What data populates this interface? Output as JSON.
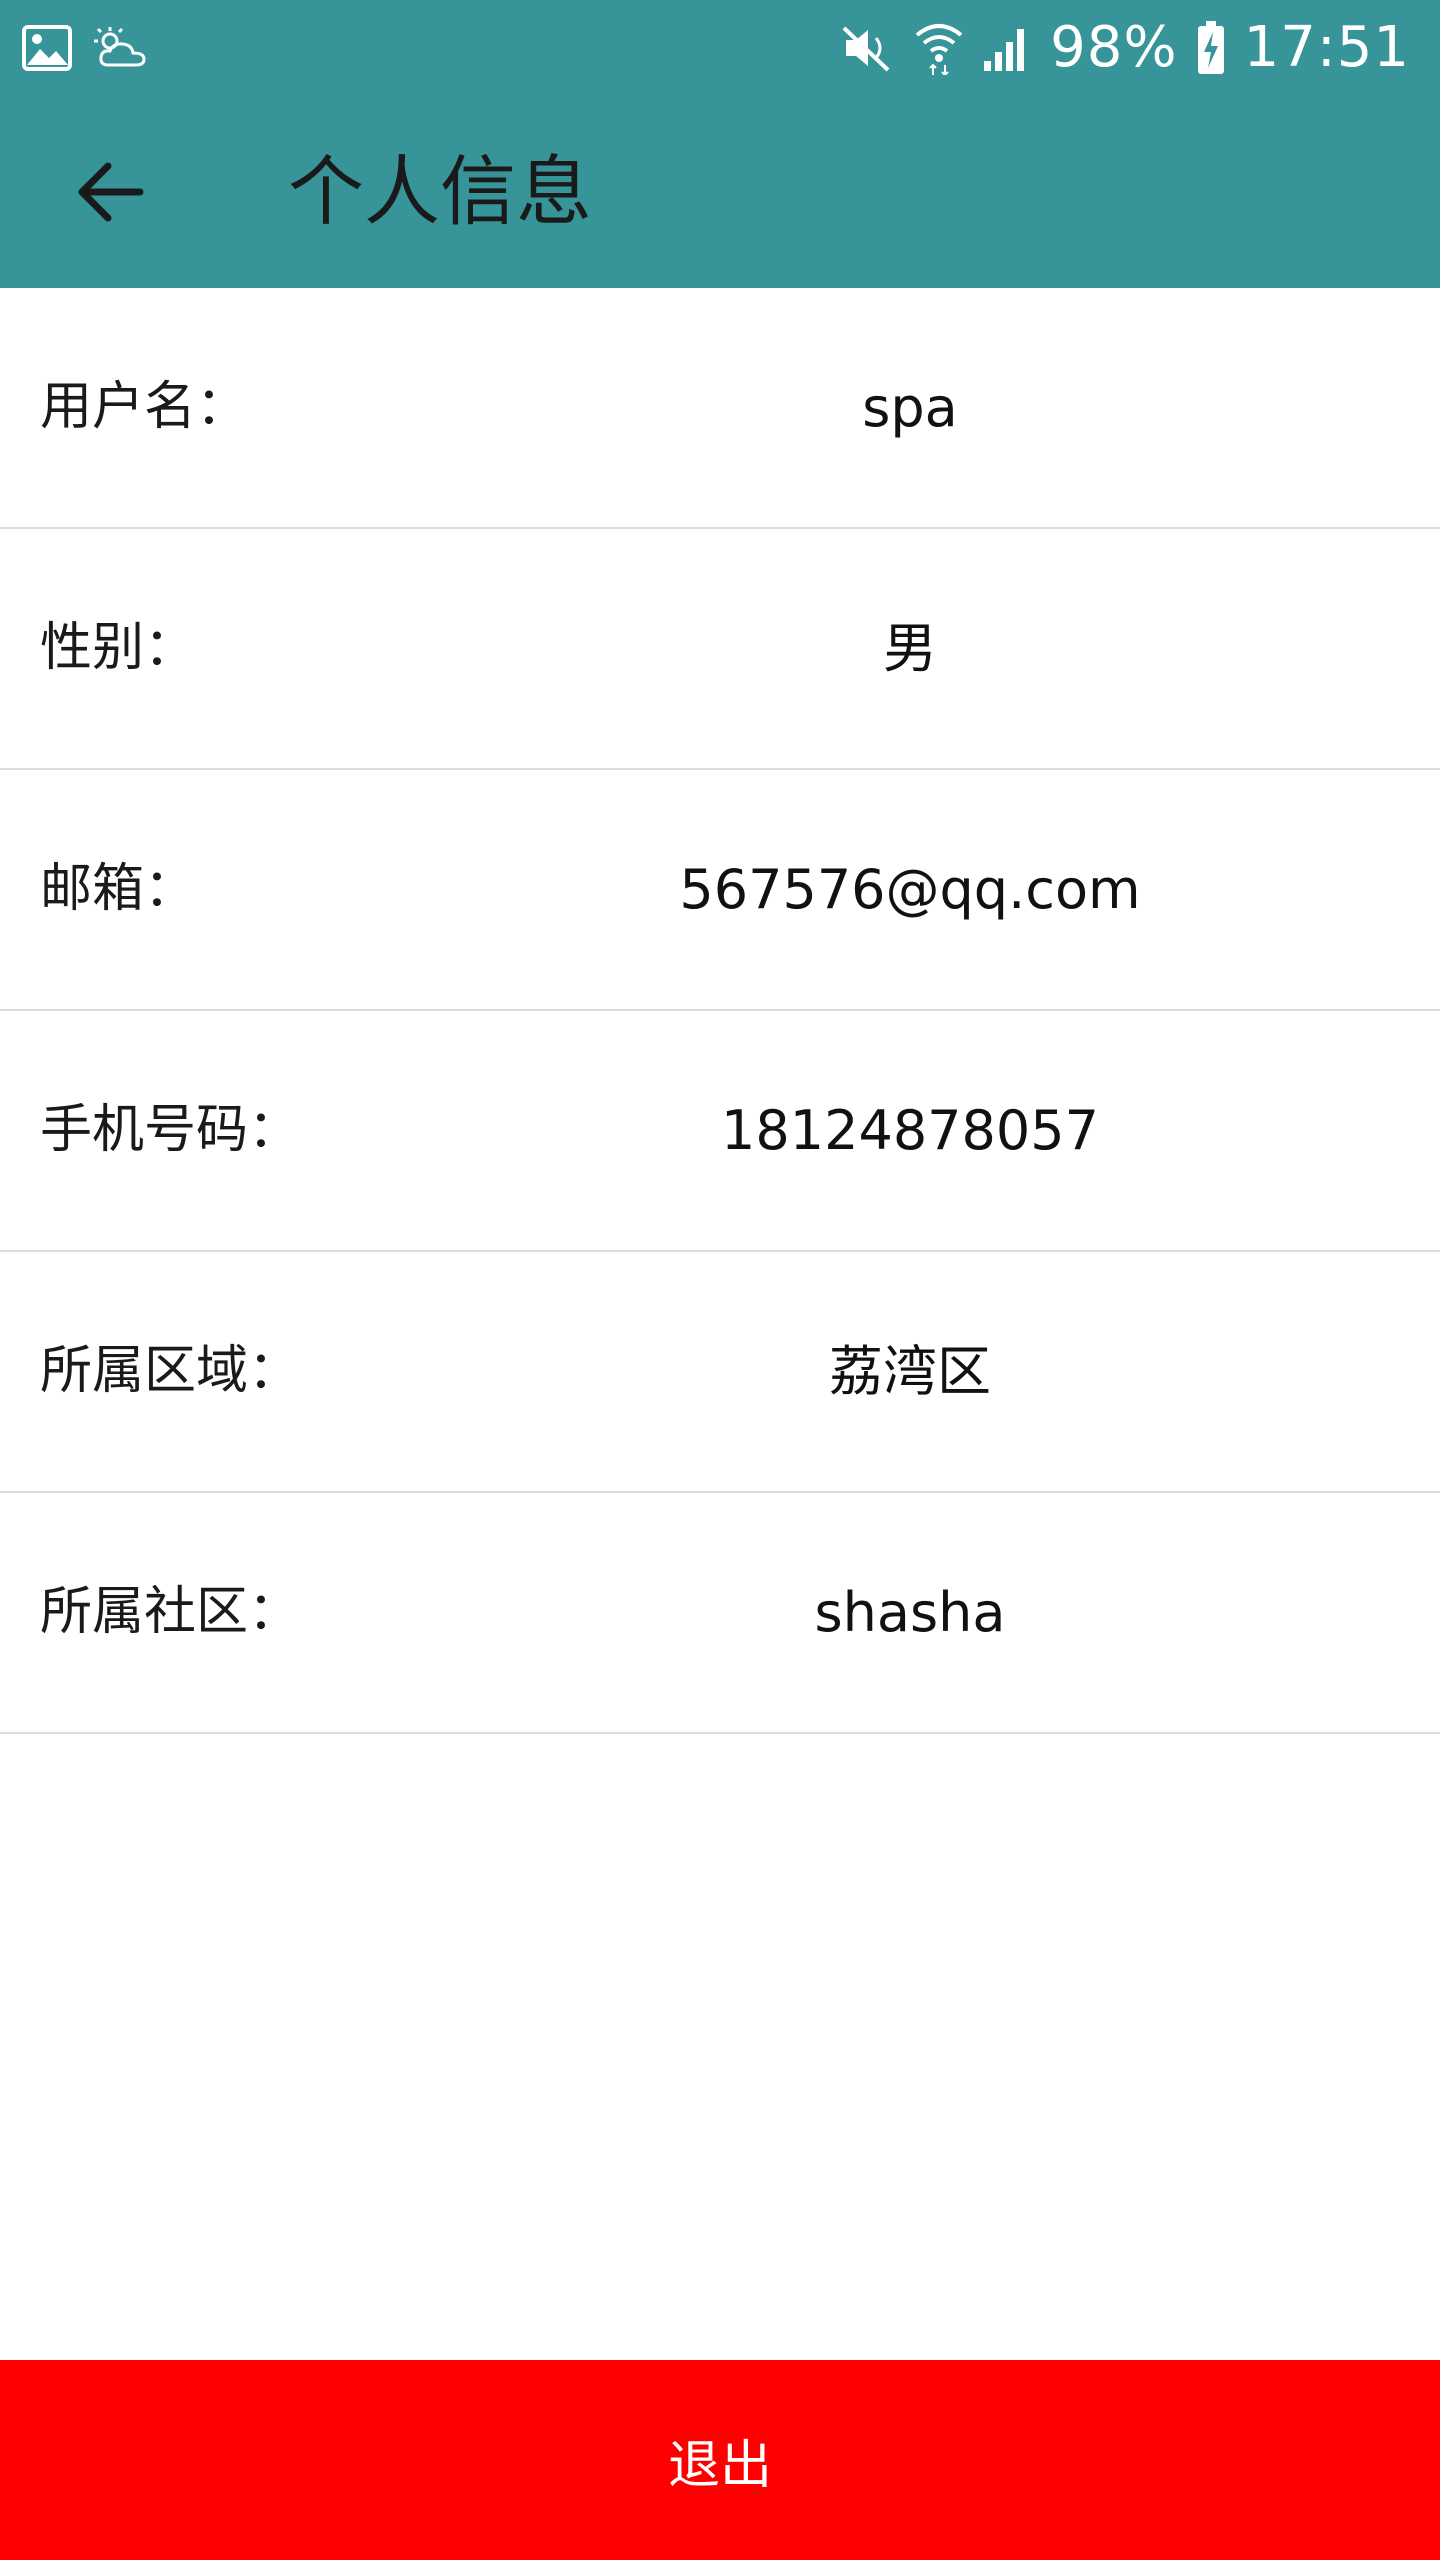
{
  "status_bar": {
    "left_icons": [
      "image-icon",
      "weather-cloud-icon"
    ],
    "right_icons": [
      "mute-icon",
      "wifi-icon",
      "signal-icon",
      "battery-charging-icon"
    ],
    "battery": "98%",
    "time": "17:51"
  },
  "app_bar": {
    "back_icon": "arrow-left-icon",
    "title": "个人信息",
    "background": "#37959a"
  },
  "profile": {
    "rows": [
      {
        "label": "用户名：",
        "value": "spa"
      },
      {
        "label": "性别：",
        "value": "男"
      },
      {
        "label": "邮箱：",
        "value": "567576@qq.com"
      },
      {
        "label": "手机号码：",
        "value": "18124878057"
      },
      {
        "label": "所属区域：",
        "value": "荔湾区"
      },
      {
        "label": "所属社区：",
        "value": "shasha"
      }
    ]
  },
  "logout": {
    "label": "退出",
    "background": "#ff0000"
  }
}
